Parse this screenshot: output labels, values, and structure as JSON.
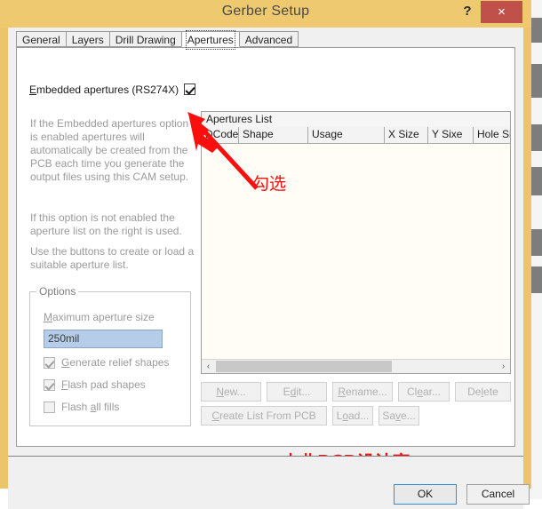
{
  "window": {
    "title": "Gerber Setup",
    "help_label": "?",
    "close_label": "×",
    "frame_color": "#eec970",
    "close_color": "#c0504a"
  },
  "tabs": [
    {
      "label": "General",
      "selected": false
    },
    {
      "label": "Layers",
      "selected": false
    },
    {
      "label": "Drill Drawing",
      "selected": false
    },
    {
      "label": "Apertures",
      "selected": true
    },
    {
      "label": "Advanced",
      "selected": false
    }
  ],
  "left_pane": {
    "embedded_label": "Embedded apertures (RS274X)",
    "embedded_checked": true,
    "descriptions": [
      "If the Embedded apertures option is enabled apertures will automatically be created from the PCB each time you generate the output files using this CAM setup.",
      "If this option is not enabled the aperture list on the right is used.",
      "Use the buttons to create or load a suitable aperture list."
    ],
    "options": {
      "legend": "Options",
      "max_aperture_label": "Maximum aperture size",
      "max_aperture_value": "250mil",
      "checkboxes": [
        {
          "label": "Generate relief shapes",
          "checked": true
        },
        {
          "label": "Flash pad shapes",
          "checked": true
        },
        {
          "label": "Flash all fills",
          "checked": false
        }
      ]
    }
  },
  "right_pane": {
    "list_title": "Apertures List",
    "columns": [
      "DCode",
      "Shape",
      "Usage",
      "X Size",
      "Y Sixe",
      "Hole Size"
    ],
    "rows": [],
    "scrollbar": {
      "left_arrow": "‹",
      "right_arrow": "›"
    },
    "buttons": [
      {
        "id": "new",
        "label": "New...",
        "enabled": false
      },
      {
        "id": "edit",
        "label": "Edit...",
        "enabled": false
      },
      {
        "id": "rename",
        "label": "Rename...",
        "enabled": false
      },
      {
        "id": "clear",
        "label": "Clear...",
        "enabled": false
      },
      {
        "id": "delete",
        "label": "Delete",
        "enabled": false
      },
      {
        "id": "create",
        "label": "Create List From PCB",
        "enabled": false
      },
      {
        "id": "load",
        "label": "Load...",
        "enabled": false
      },
      {
        "id": "save",
        "label": "Save...",
        "enabled": false
      }
    ]
  },
  "annotations": {
    "arrow_color": "#fb0e0e",
    "check_note": "勾选",
    "watermark": "小北PCB设计室"
  },
  "footer": {
    "ok_label": "OK",
    "cancel_label": "Cancel"
  }
}
